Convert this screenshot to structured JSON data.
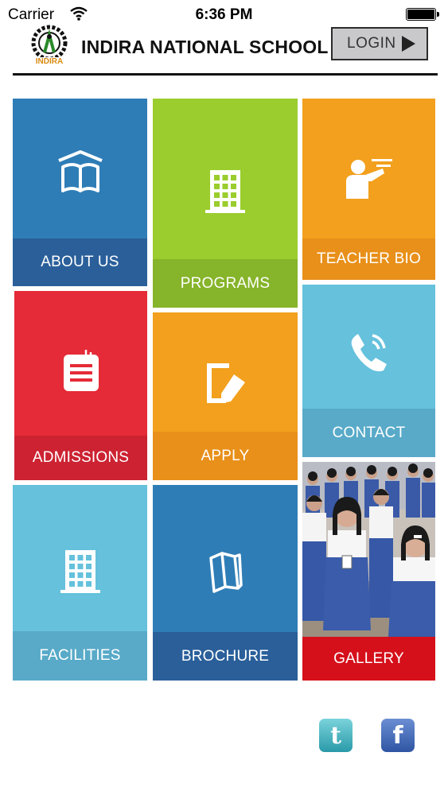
{
  "status_bar": {
    "carrier": "Carrier",
    "time": "6:36 PM"
  },
  "header": {
    "logo_text": "INDIRA",
    "title": "INDIRA NATIONAL SCHOOL",
    "login_label": "LOGIN"
  },
  "tiles": [
    {
      "label": "ABOUT US",
      "icon": "open-book-icon",
      "color": "#2f7db6",
      "bar_color": "#2a5f9a"
    },
    {
      "label": "PROGRAMS",
      "icon": "building-icon",
      "color": "#9acd2d",
      "bar_color": "#86b42a"
    },
    {
      "label": "TEACHER BIO",
      "icon": "teacher-icon",
      "color": "#f2a01d",
      "bar_color": "#e8901a"
    },
    {
      "label": "ADMISSIONS",
      "icon": "notepad-icon",
      "color": "#e52b37",
      "bar_color": "#cc2232"
    },
    {
      "label": "APPLY",
      "icon": "edit-document-icon",
      "color": "#f2a01d",
      "bar_color": "#e8901a"
    },
    {
      "label": "CONTACT",
      "icon": "phone-icon",
      "color": "#65c1dc",
      "bar_color": "#58aac8"
    },
    {
      "label": "FACILITIES",
      "icon": "building-icon",
      "color": "#65c1dc",
      "bar_color": "#58aac8"
    },
    {
      "label": "BROCHURE",
      "icon": "brochure-icon",
      "color": "#2f7db6",
      "bar_color": "#2a5f9a"
    },
    {
      "label": "GALLERY",
      "icon": "students-photo",
      "color": "#d5d5d5",
      "bar_color": "#d5101a"
    }
  ],
  "social": {
    "twitter": "t",
    "facebook": "f"
  }
}
